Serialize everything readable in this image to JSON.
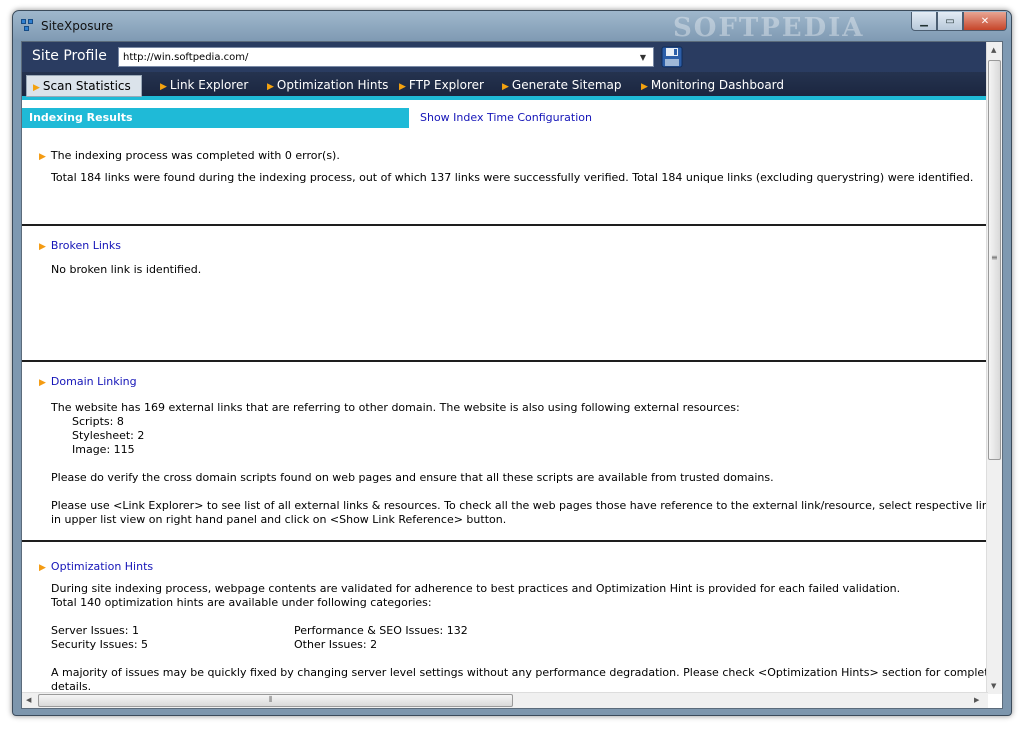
{
  "window": {
    "title": "SiteXposure",
    "watermark": "SOFTPEDIA"
  },
  "profile": {
    "label": "Site Profile",
    "url": "http://win.softpedia.com/"
  },
  "nav": [
    {
      "label": "Scan Statistics"
    },
    {
      "label": "Link Explorer"
    },
    {
      "label": "Optimization Hints"
    },
    {
      "label": "FTP Explorer"
    },
    {
      "label": "Generate Sitemap"
    },
    {
      "label": "Monitoring Dashboard"
    }
  ],
  "results": {
    "tab_label": "Indexing Results",
    "config_link": "Show Index Time Configuration",
    "completed": "The indexing process was completed with 0 error(s).",
    "summary": "Total 184 links were found during the indexing process, out of which 137 links were successfully verified. Total 184 unique links (excluding querystring) were identified."
  },
  "broken": {
    "heading": "Broken Links",
    "text": "No broken link is identified."
  },
  "domain": {
    "heading": "Domain Linking",
    "intro": "The website has 169 external links that are referring to other domain. The website is also using following external resources:",
    "scripts": "Scripts: 8",
    "stylesheet": "Stylesheet: 2",
    "image": "Image: 115",
    "verify": "Please do verify the cross domain scripts found on web pages and ensure that all these scripts are available from trusted domains.",
    "use_line1": "Please use <Link Explorer> to see list of all external links & resources. To check all the web pages those have reference to the external link/resource, select respective link",
    "use_line2": "in upper list view on right hand panel and click on <Show Link Reference> button."
  },
  "hints": {
    "heading": "Optimization Hints",
    "line1": "During site indexing process, webpage contents are validated for adherence to best practices and Optimization Hint is provided for each failed validation.",
    "line2": "Total 140 optimization hints are available under following categories:",
    "server": "Server Issues: 1",
    "perf": "Performance & SEO Issues: 132",
    "security": "Security Issues: 5",
    "other": "Other Issues: 2",
    "majority1": "A majority of issues may be quickly fixed by changing server level settings without any performance degradation.  Please check <Optimization Hints> section for complete",
    "majority2": "details."
  },
  "colors": {
    "accent": "#1fbad7",
    "nav_bg": "#1b2640",
    "link": "#1515b8",
    "arrow": "#f49b12"
  }
}
